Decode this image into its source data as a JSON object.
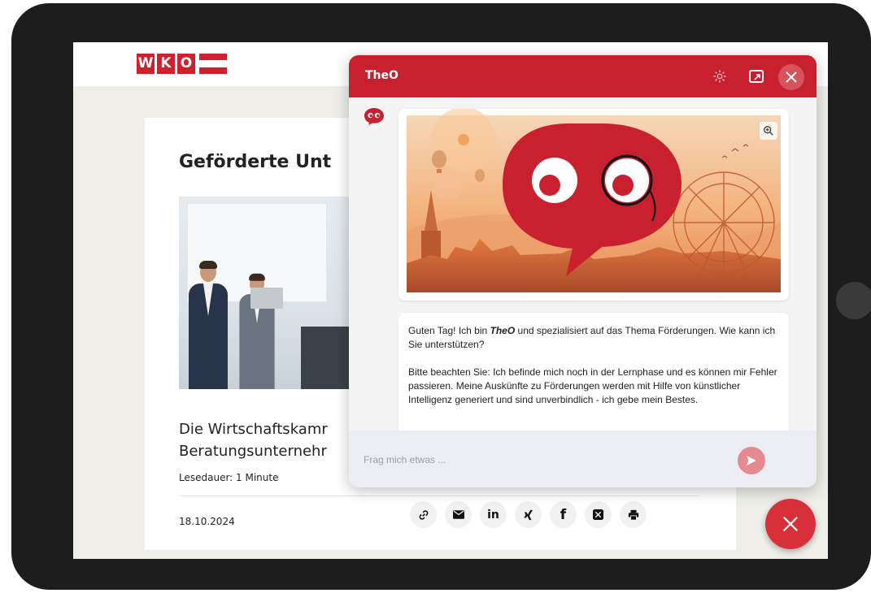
{
  "site": {
    "logo_letters": [
      "W",
      "K",
      "O"
    ],
    "brand_color": "#d1202d"
  },
  "article": {
    "headline": "Geförderte Unt",
    "teaser_line1": "Die Wirtschaftskamr",
    "teaser_line2": "Beratungsunternehr",
    "reading_time": "Lesedauer: 1 Minute",
    "date": "18.10.2024",
    "share_buttons": [
      {
        "icon": "link-icon",
        "glyph": "🔗"
      },
      {
        "icon": "email-icon",
        "glyph": "✉"
      },
      {
        "icon": "linkedin-icon",
        "glyph": "in"
      },
      {
        "icon": "xing-icon",
        "glyph": "✗"
      },
      {
        "icon": "facebook-icon",
        "glyph": "f"
      },
      {
        "icon": "x-icon",
        "glyph": "𝕏"
      },
      {
        "icon": "print-icon",
        "glyph": "⎙"
      }
    ]
  },
  "chat": {
    "title": "TheO",
    "header_color": "#c8202e",
    "greeting_before": "Guten Tag! Ich bin ",
    "greeting_name": "TheO",
    "greeting_after": " und spezialisiert auf das Thema Förderungen. Wie kann ich Sie unterstützen?",
    "notice": "Bitte beachten Sie: Ich befinde mich noch in der Lernphase und es können mir Fehler passieren. Meine Auskünfte zu Förderungen werden mit Hilfe von künstlicher Intelligenz generiert und sind unverbindlich - ich gebe mein Bestes.",
    "input_placeholder": "Frag mich etwas ..."
  }
}
